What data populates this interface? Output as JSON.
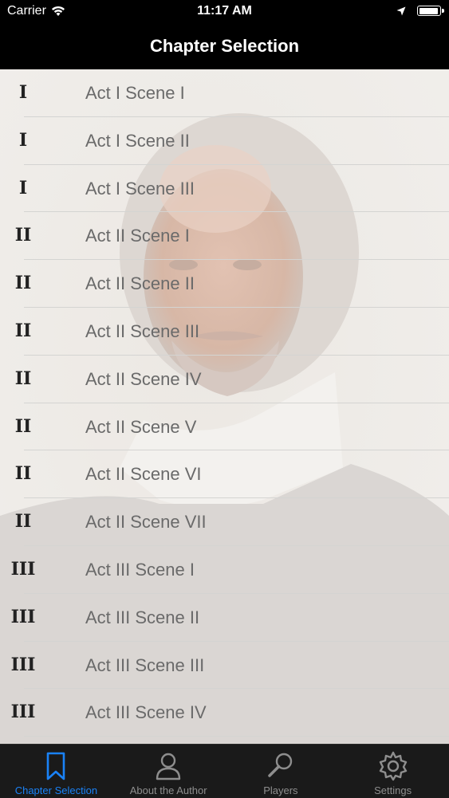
{
  "status_bar": {
    "carrier": "Carrier",
    "time": "11:17 AM"
  },
  "nav_bar": {
    "title": "Chapter Selection"
  },
  "chapters": [
    {
      "act": "I",
      "title": "Act I Scene I"
    },
    {
      "act": "I",
      "title": "Act I Scene II"
    },
    {
      "act": "I",
      "title": "Act I Scene III"
    },
    {
      "act": "II",
      "title": "Act II Scene I"
    },
    {
      "act": "II",
      "title": "Act II Scene II"
    },
    {
      "act": "II",
      "title": "Act II Scene III"
    },
    {
      "act": "II",
      "title": "Act II Scene IV"
    },
    {
      "act": "II",
      "title": "Act II Scene V"
    },
    {
      "act": "II",
      "title": "Act II Scene VI"
    },
    {
      "act": "II",
      "title": "Act II Scene VII"
    },
    {
      "act": "III",
      "title": "Act III Scene I"
    },
    {
      "act": "III",
      "title": "Act III Scene II"
    },
    {
      "act": "III",
      "title": "Act III Scene III"
    },
    {
      "act": "III",
      "title": "Act III Scene IV"
    }
  ],
  "tab_bar": {
    "tabs": [
      {
        "label": "Chapter Selection",
        "icon": "bookmark-icon",
        "active": true
      },
      {
        "label": "About the Author",
        "icon": "person-icon",
        "active": false
      },
      {
        "label": "Players",
        "icon": "magnifier-icon",
        "active": false
      },
      {
        "label": "Settings",
        "icon": "gear-icon",
        "active": false
      }
    ]
  },
  "colors": {
    "active_tab": "#1a82f7",
    "inactive_tab": "#8e8e8e"
  }
}
